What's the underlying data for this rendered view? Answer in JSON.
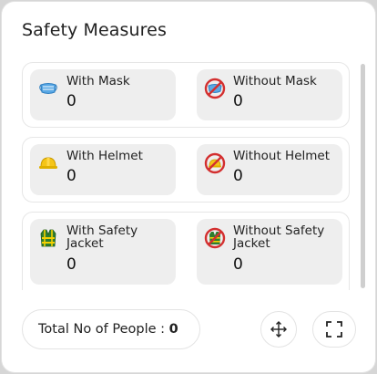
{
  "widget": {
    "title": "Safety Measures",
    "total_label": "Total No of People : ",
    "total_value": "0"
  },
  "stats": {
    "with_mask": {
      "label": "With Mask",
      "value": "0",
      "icon": "mask-icon"
    },
    "without_mask": {
      "label": "Without Mask",
      "value": "0",
      "icon": "no-mask-icon"
    },
    "with_helmet": {
      "label": "With Helmet",
      "value": "0",
      "icon": "helmet-icon"
    },
    "without_helmet": {
      "label": "Without Helmet",
      "value": "0",
      "icon": "no-helmet-icon"
    },
    "with_jacket": {
      "label": "With Safety Jacket",
      "value": "0",
      "icon": "safety-jacket-icon"
    },
    "without_jacket": {
      "label": "Without Safety Jacket",
      "value": "0",
      "icon": "no-safety-jacket-icon"
    }
  },
  "actions": {
    "move_icon": "move-arrows-icon",
    "expand_icon": "fullscreen-icon"
  },
  "colors": {
    "no_sign_red": "#d32f2f",
    "mask_blue": "#4a9ee0",
    "helmet_yellow": "#f5c518",
    "jacket_green": "#3aa83a",
    "tile_bg": "#eeeeee"
  }
}
